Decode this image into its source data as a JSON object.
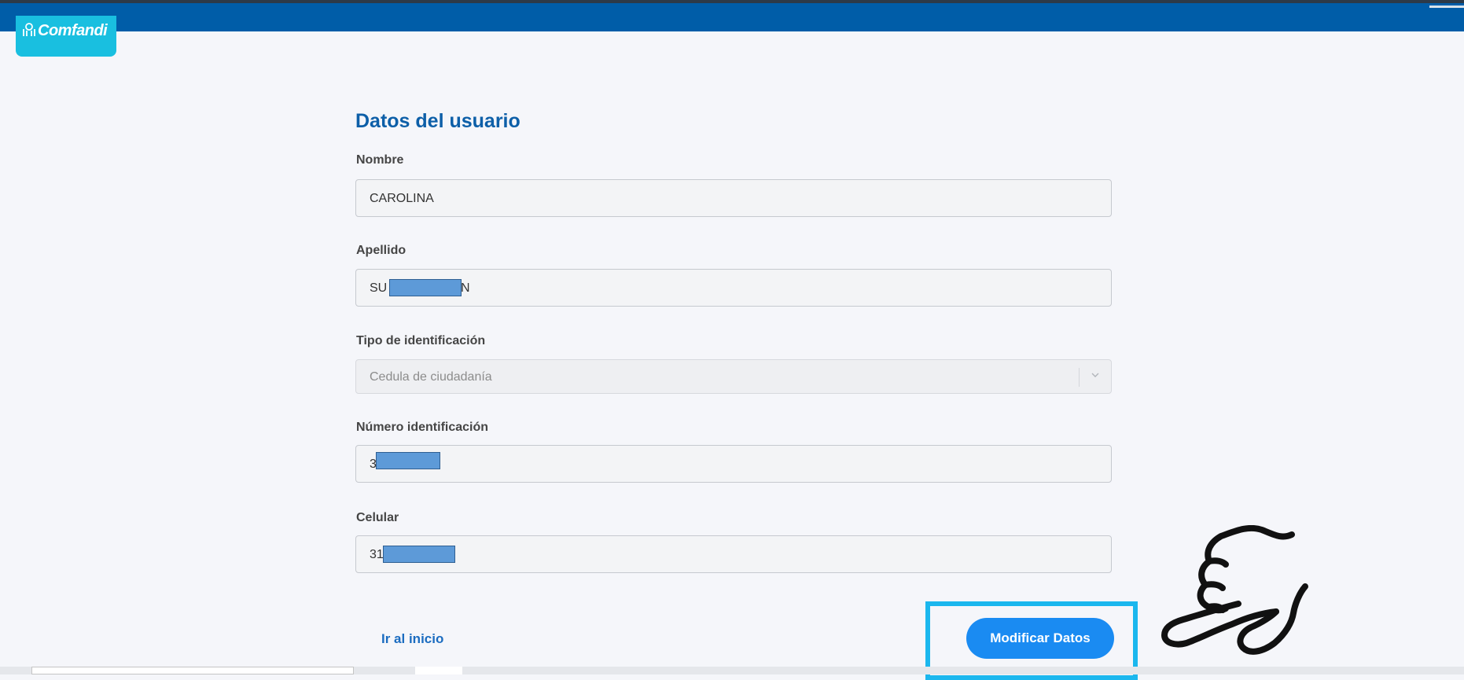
{
  "header": {
    "brand": "Comfandi",
    "colors": {
      "bar": "#005da8",
      "logo_bg": "#19bfe0"
    }
  },
  "form": {
    "title": "Datos del usuario",
    "nombre": {
      "label": "Nombre",
      "value": "CAROLINA"
    },
    "apellido": {
      "label": "Apellido",
      "value_start": "SU",
      "value_end": "N"
    },
    "tipo_identificacion": {
      "label": "Tipo de identificación",
      "selected": "Cedula de ciudadanía"
    },
    "numero_identificacion": {
      "label": "Número identificación",
      "value_start": "3"
    },
    "celular": {
      "label": "Celular",
      "value_start": "31"
    }
  },
  "actions": {
    "home_link": "Ir al inicio",
    "modify_button": "Modificar Datos",
    "accent_color": "#1a8bf2",
    "highlight_color": "#1bb7ee"
  },
  "icons": {
    "logo": "comfandi-logo-icon",
    "select": "chevron-down-icon",
    "pointer": "pointing-hand-icon"
  }
}
